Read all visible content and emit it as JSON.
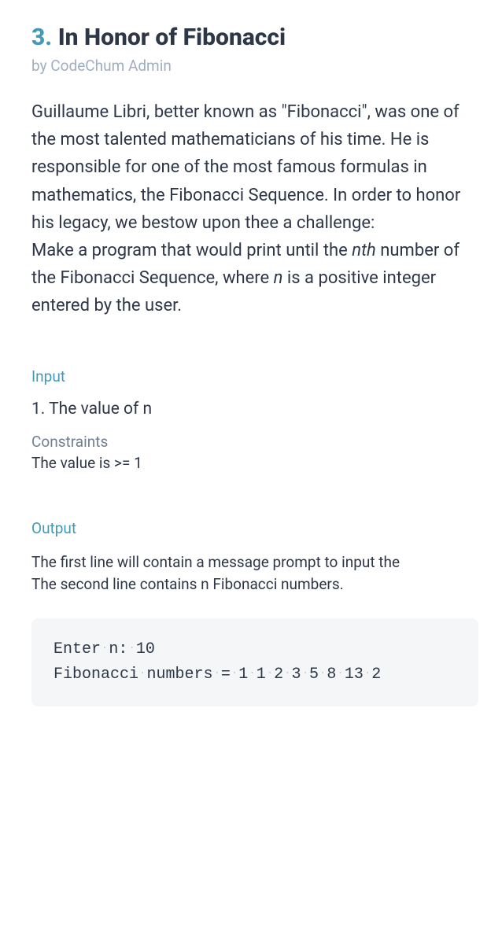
{
  "problem": {
    "number": "3.",
    "title": "In Honor of Fibonacci",
    "byline": "by CodeChum Admin",
    "description_part1": "Guillaume Libri, better known as \"Fibonacci\", was one of the most talented mathematicians of his time. He is responsible for one of the most famous formulas in mathematics, the Fibonacci Sequence. In order to honor his legacy, we bestow upon thee a challenge:",
    "description_part2a": "Make a program that would print until the ",
    "description_nth": "nth",
    "description_part2b": " number of the Fibonacci Sequence, where ",
    "description_n": "n",
    "description_part2c": " is a positive integer entered by the user."
  },
  "input": {
    "label": "Input",
    "item": "1. The value of n",
    "constraints_label": "Constraints",
    "constraints_text": "The value is >= 1"
  },
  "output": {
    "label": "Output",
    "line1": "The first line will contain a message prompt to input the",
    "line2": "The second line contains n Fibonacci numbers."
  },
  "code": {
    "line1_a": "Enter",
    "line1_b": "n:",
    "line1_c": "10",
    "line2_a": "Fibonacci",
    "line2_b": "numbers",
    "line2_c": "=",
    "seq": [
      "1",
      "1",
      "2",
      "3",
      "5",
      "8",
      "13",
      "2"
    ]
  }
}
